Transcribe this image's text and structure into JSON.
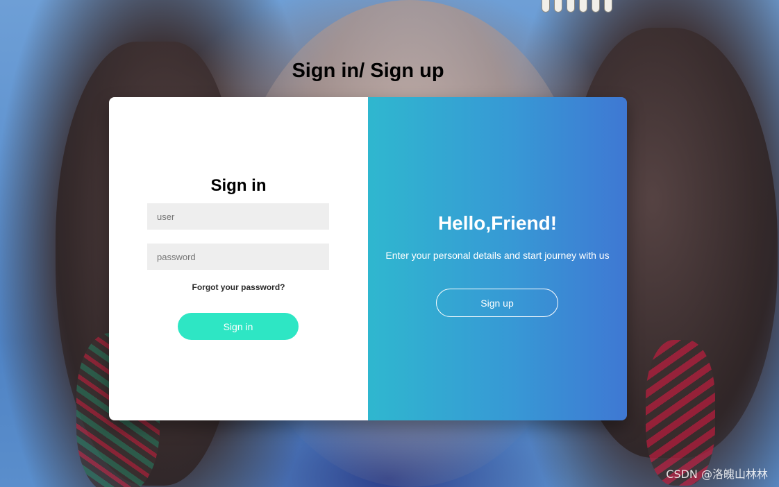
{
  "page": {
    "title": "Sign in/ Sign up"
  },
  "signin": {
    "heading": "Sign in",
    "user_placeholder": "user",
    "password_placeholder": "password",
    "forgot_label": "Forgot your password?",
    "button_label": "Sign in",
    "button_color": "#2ee6c4"
  },
  "welcome": {
    "heading": "Hello,Friend!",
    "text": "Enter your personal details and start journey with us",
    "button_label": "Sign up",
    "gradient_start": "#2fb7cf",
    "gradient_end": "#3f78d3"
  },
  "watermark": {
    "text": "CSDN @洛魄山林林"
  }
}
